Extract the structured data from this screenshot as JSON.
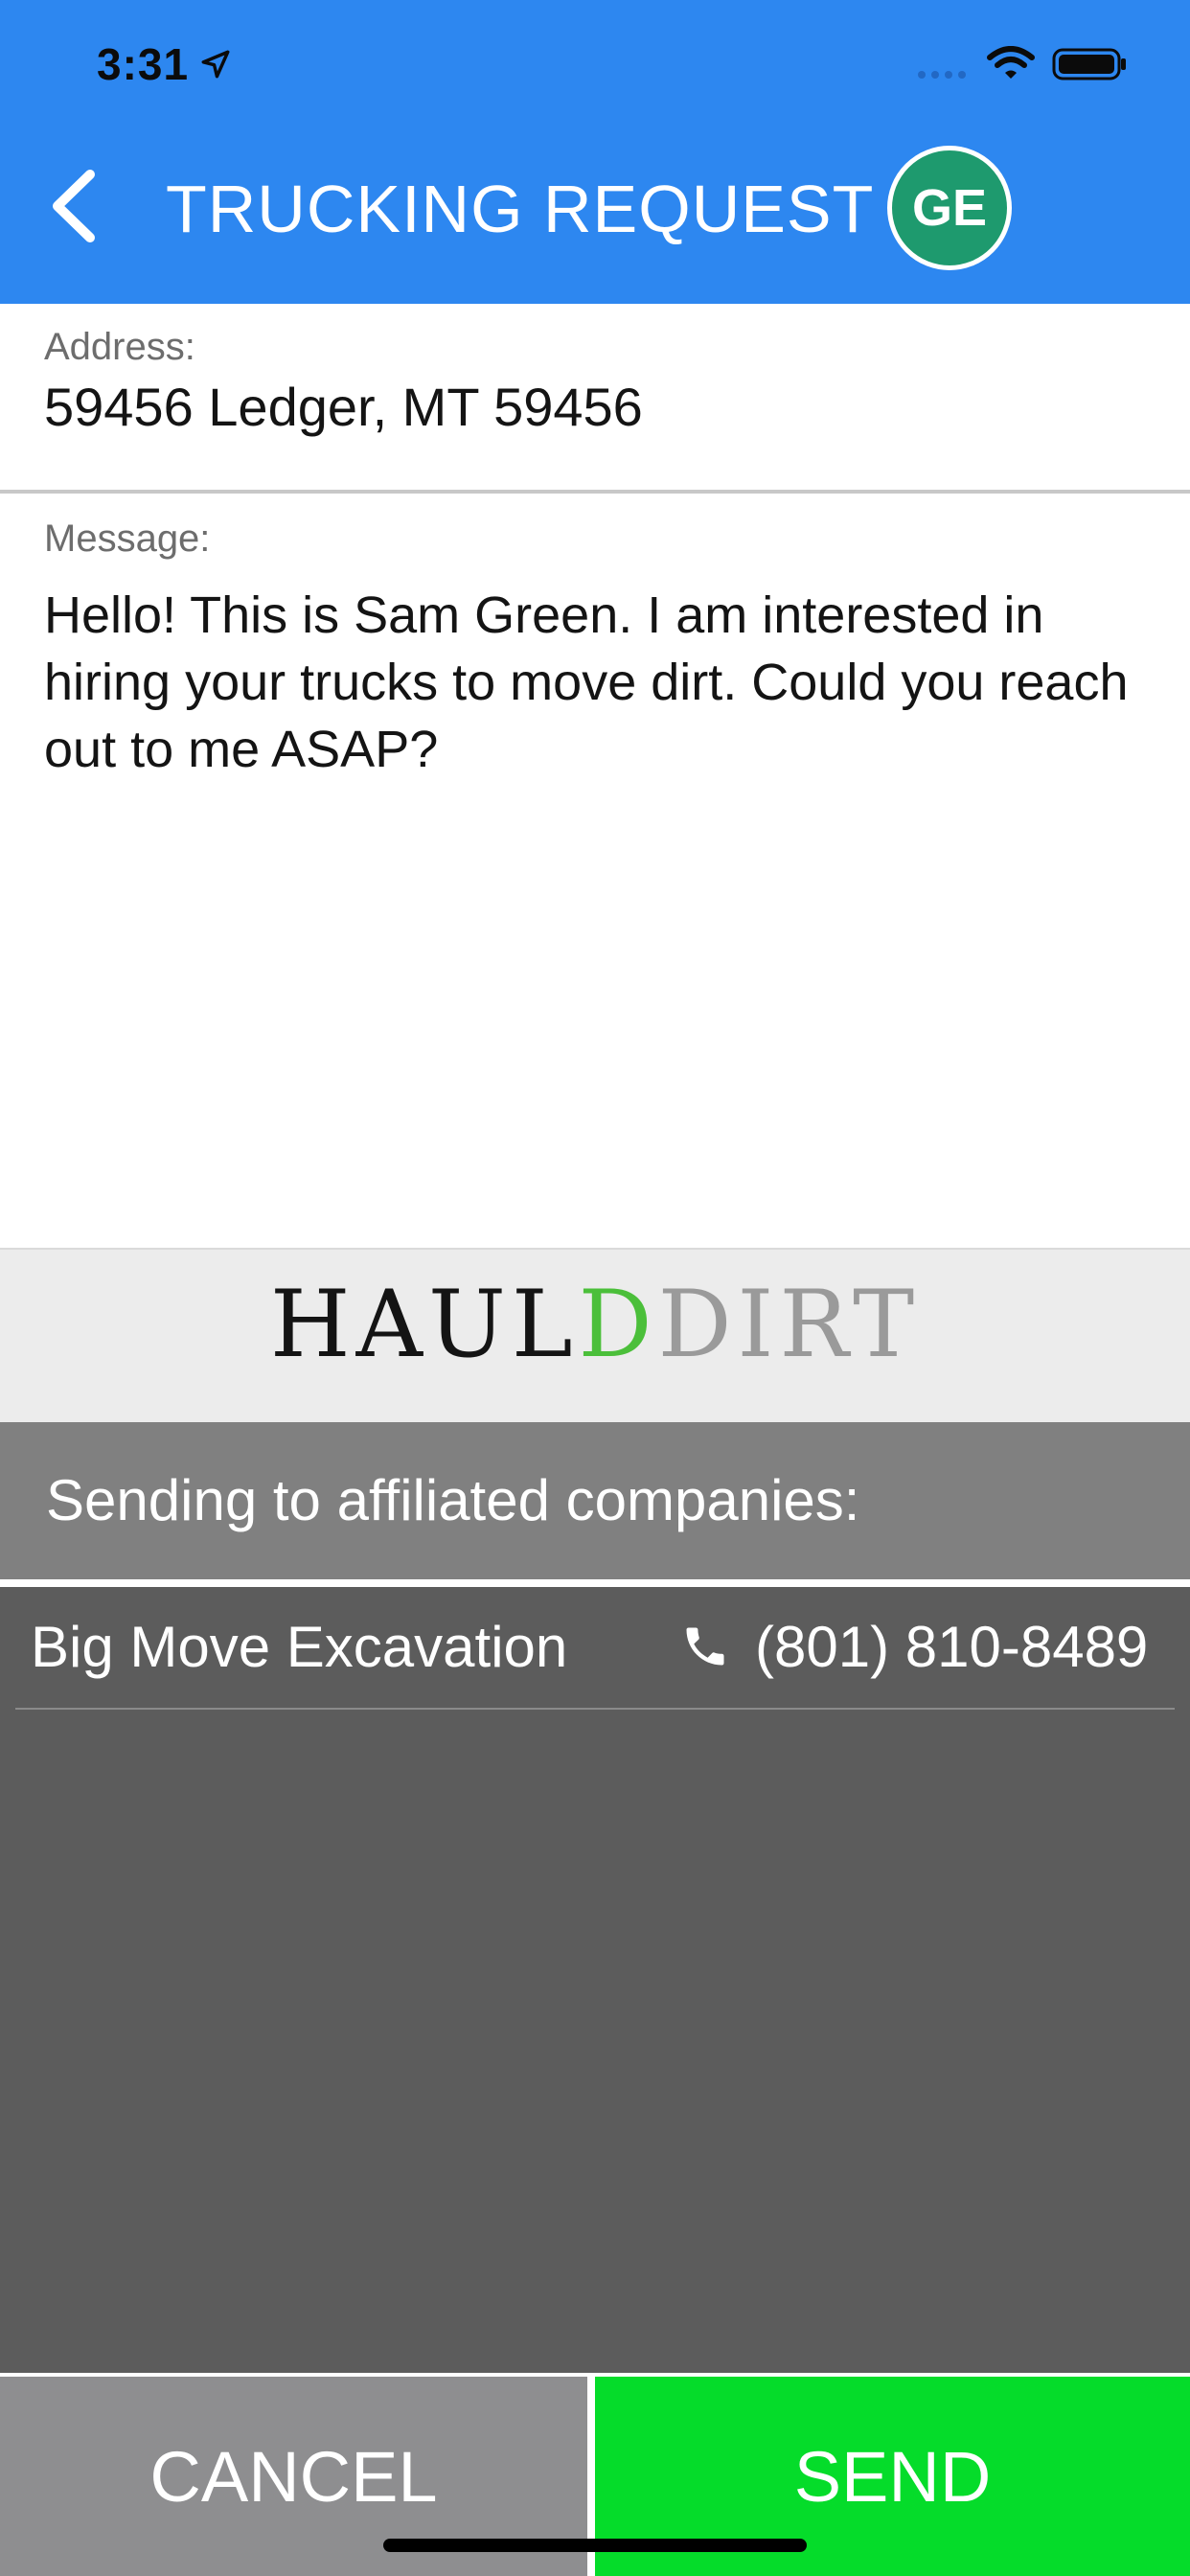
{
  "status_bar": {
    "time": "3:31",
    "icons": [
      "location-arrow-icon",
      "signal-icon",
      "wifi-icon",
      "battery-icon"
    ]
  },
  "header": {
    "title": "TRUCKING REQUEST",
    "avatar_initials": "GE",
    "background_color": "#2d87f0",
    "avatar_color": "#1e9a6e"
  },
  "address": {
    "label": "Address:",
    "value": "59456 Ledger, MT 59456"
  },
  "message": {
    "label": "Message:",
    "value": "Hello! This is Sam Green. I am interested in hiring your trucks to move dirt. Could you reach out to me ASAP?"
  },
  "logo": {
    "part1": "HAUL",
    "part2": "D",
    "part3": "DIRT",
    "colors": {
      "haul": "#141414",
      "d": "#4bbf3a",
      "dirt": "#9a9a9a"
    }
  },
  "affiliates": {
    "heading": "Sending to affiliated companies:",
    "companies": [
      {
        "name": "Big Move Excavation",
        "phone": "(801) 810-8489"
      }
    ]
  },
  "actions": {
    "cancel_label": "CANCEL",
    "send_label": "SEND",
    "cancel_color": "#8e8e90",
    "send_color": "#05dc2a"
  }
}
